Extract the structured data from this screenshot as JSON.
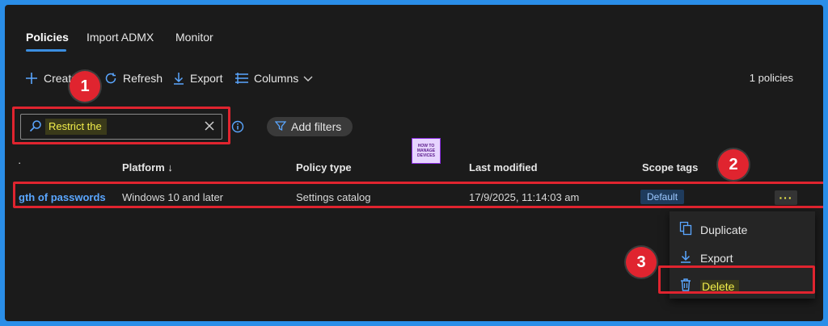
{
  "tabs": [
    {
      "label": "Policies",
      "active": true
    },
    {
      "label": "Import ADMX",
      "active": false
    },
    {
      "label": "Monitor",
      "active": false
    }
  ],
  "toolbar": {
    "create": "Create",
    "refresh": "Refresh",
    "export": "Export",
    "columns": "Columns",
    "count": "1 policies"
  },
  "search": {
    "value": "Restrict the"
  },
  "filters": {
    "add_label": "Add filters"
  },
  "table": {
    "headers": {
      "name": "·",
      "platform": "Platform ↓",
      "policy_type": "Policy type",
      "last_modified": "Last modified",
      "scope_tags": "Scope tags"
    },
    "rows": [
      {
        "name": "gth of passwords",
        "platform": "Windows 10 and later",
        "policy_type": "Settings catalog",
        "last_modified": "17/9/2025, 11:14:03 am",
        "scope_tag": "Default",
        "more": "···"
      }
    ]
  },
  "context_menu": {
    "items": [
      {
        "label": "Duplicate",
        "icon": "duplicate-icon"
      },
      {
        "label": "Export",
        "icon": "download-icon"
      },
      {
        "label": "Delete",
        "icon": "trash-icon"
      }
    ]
  },
  "annotations": {
    "step1": "1",
    "step2": "2",
    "step3": "3"
  },
  "logo": {
    "line1": "HOW TO",
    "line2": "MANAGE",
    "line3": "DEVICES"
  },
  "colors": {
    "accent": "#3b8ee0",
    "highlight": "#f2ee4b",
    "annotation_red": "#e0242f",
    "frame_border": "#2a8ee8"
  }
}
